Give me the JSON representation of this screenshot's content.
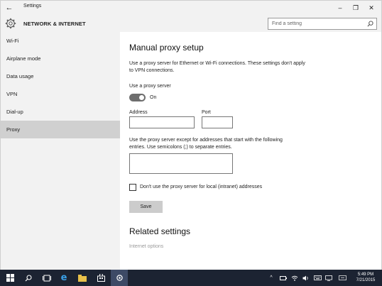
{
  "window": {
    "title": "Settings",
    "controls": {
      "minimize": "–",
      "maximize": "❐",
      "close": "✕"
    }
  },
  "header": {
    "section_title": "NETWORK & INTERNET",
    "search_placeholder": "Find a setting"
  },
  "sidebar": {
    "items": [
      {
        "label": "Wi-Fi"
      },
      {
        "label": "Airplane mode"
      },
      {
        "label": "Data usage"
      },
      {
        "label": "VPN"
      },
      {
        "label": "Dial-up"
      },
      {
        "label": "Proxy",
        "active": true
      }
    ]
  },
  "content": {
    "title": "Manual proxy setup",
    "description": "Use a proxy server for Ethernet or Wi-Fi connections. These settings don't apply to VPN connections.",
    "use_proxy_label": "Use a proxy server",
    "toggle_state": "On",
    "address_label": "Address",
    "address_value": "",
    "port_label": "Port",
    "port_value": "",
    "exceptions_description": "Use the proxy server except for addresses that start with the following entries. Use semicolons (;) to separate entries.",
    "exceptions_value": "",
    "local_checkbox_label": "Don't use the proxy server for local (intranet) addresses",
    "local_checkbox_checked": false,
    "save_label": "Save",
    "related_title": "Related settings",
    "related_link": "Internet options"
  },
  "taskbar": {
    "items": [
      "windows-icon",
      "search-icon",
      "task-view-icon",
      "edge-icon",
      "file-explorer-icon",
      "store-icon",
      "settings-icon"
    ],
    "clock_time": "5:49 PM",
    "clock_date": "7/21/2015"
  },
  "colors": {
    "accent_bg": "#f2f2f2",
    "active_nav": "#d0d0d0",
    "toggle_on": "#6e6e6e",
    "taskbar": "#1c2332"
  }
}
